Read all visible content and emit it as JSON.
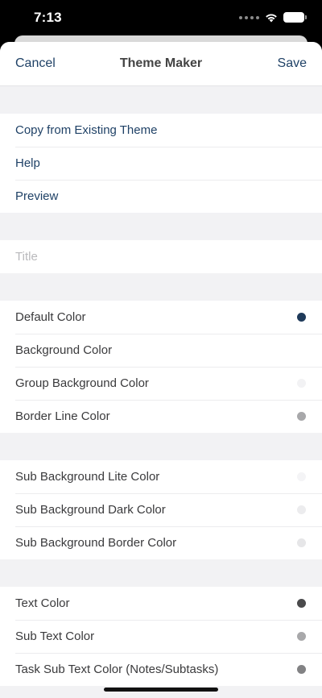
{
  "status": {
    "time": "7:13"
  },
  "nav": {
    "cancel": "Cancel",
    "title": "Theme Maker",
    "save": "Save"
  },
  "actions": [
    {
      "label": "Copy from Existing Theme"
    },
    {
      "label": "Help"
    },
    {
      "label": "Preview"
    }
  ],
  "title_field": {
    "placeholder": "Title",
    "value": ""
  },
  "group_main": [
    {
      "label": "Default Color",
      "color": "#1f3a5a"
    },
    {
      "label": "Background Color",
      "color": "#ffffff"
    },
    {
      "label": "Group Background Color",
      "color": "#f2f2f4"
    },
    {
      "label": "Border Line Color",
      "color": "#a8a8aa"
    }
  ],
  "group_sub": [
    {
      "label": "Sub Background Lite Color",
      "color": "#f4f4f6"
    },
    {
      "label": "Sub Background Dark Color",
      "color": "#ececee"
    },
    {
      "label": "Sub Background Border Color",
      "color": "#e6e6e8"
    }
  ],
  "group_text": [
    {
      "label": "Text Color",
      "color": "#4a4a4c"
    },
    {
      "label": "Sub Text Color",
      "color": "#a8a8aa"
    },
    {
      "label": "Task Sub Text Color (Notes/Subtasks)",
      "color": "#828284"
    }
  ]
}
